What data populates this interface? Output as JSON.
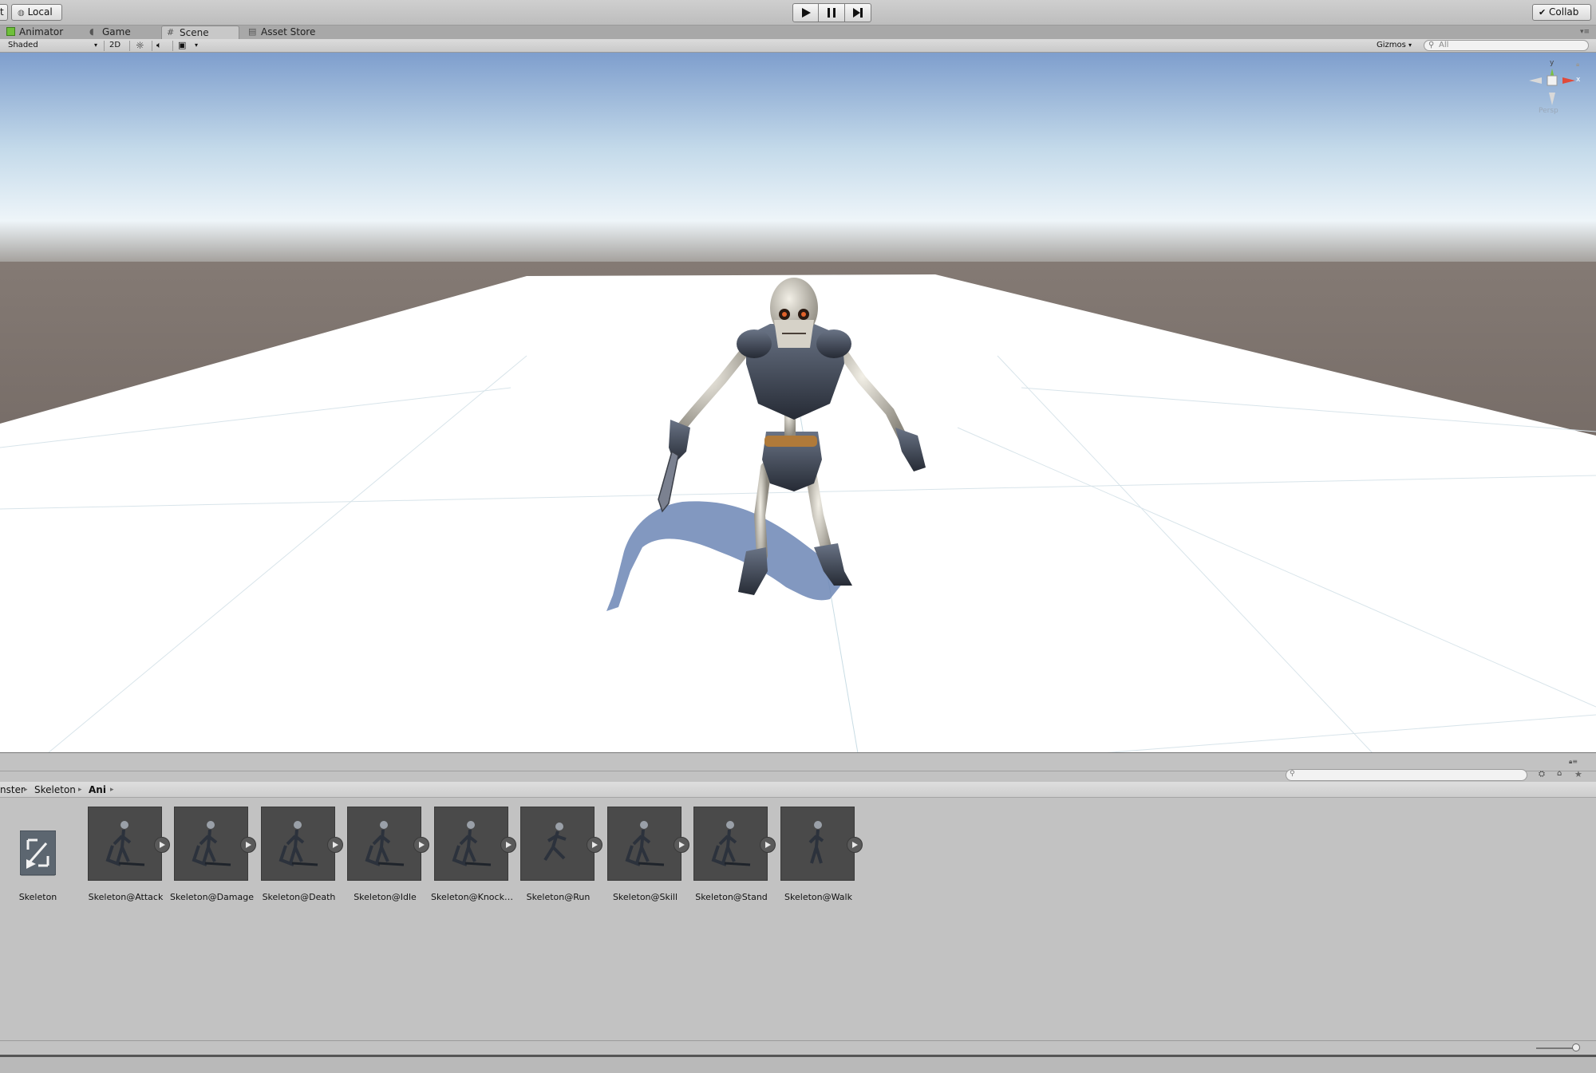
{
  "toolbar": {
    "left_label": "t",
    "local_label": "Local",
    "collab_label": "Collab"
  },
  "tabs": [
    {
      "label": "Animator",
      "active": false
    },
    {
      "label": "Game",
      "active": false
    },
    {
      "label": "Scene",
      "active": true
    },
    {
      "label": "Asset Store",
      "active": false
    }
  ],
  "scenebar": {
    "shading_mode": "Shaded",
    "toggle_2d": "2D",
    "gizmos_label": "Gizmos",
    "search_placeholder": "All"
  },
  "scene_gizmo": {
    "y_label": "y",
    "x_label": "x",
    "projection_label": "Persp"
  },
  "breadcrumb": [
    {
      "label": "nster",
      "bold": false
    },
    {
      "label": "Skeleton",
      "bold": false
    },
    {
      "label": "Ani",
      "bold": true
    }
  ],
  "assets": [
    {
      "label": "Skeleton",
      "kind": "controller"
    },
    {
      "label": "Skeleton@Attack",
      "kind": "clip"
    },
    {
      "label": "Skeleton@Damage",
      "kind": "clip"
    },
    {
      "label": "Skeleton@Death",
      "kind": "clip"
    },
    {
      "label": "Skeleton@Idle",
      "kind": "clip"
    },
    {
      "label": "Skeleton@Knock…",
      "kind": "clip"
    },
    {
      "label": "Skeleton@Run",
      "kind": "clip"
    },
    {
      "label": "Skeleton@Skill",
      "kind": "clip"
    },
    {
      "label": "Skeleton@Stand",
      "kind": "clip"
    },
    {
      "label": "Skeleton@Walk",
      "kind": "clip"
    }
  ],
  "colors": {
    "sky_top": "#7f9fcf",
    "horizon": "#e6f1f8",
    "ground_far": "#6e6460",
    "plane": "#ffffff",
    "editor_bg": "#c2c2c2",
    "thumb_bg": "#4a4a4a"
  }
}
